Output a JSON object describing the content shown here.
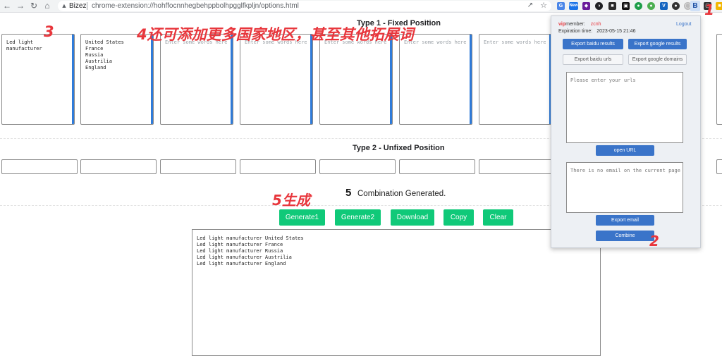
{
  "browser": {
    "site_label": "Bizez",
    "url": "chrome-extension://hohffocnnhegbehppbolhpgglfkpljn/options.html",
    "ext_badge_new": "New",
    "ext_badge_b": "B"
  },
  "type1": {
    "title": "Type 1 - Fixed Position",
    "boxes": [
      {
        "text": "Led light\nmanufacturer"
      },
      {
        "text": "United States\nFrance\nRussia\nAustrilia\nEngland"
      }
    ],
    "placeholder": "Enter some words here"
  },
  "type2": {
    "title": "Type 2 - Unfixed Position"
  },
  "generated": {
    "count": "5",
    "label": "Combination Generated.",
    "buttons": [
      "Generate1",
      "Generate2",
      "Download",
      "Copy",
      "Clear"
    ],
    "output": "Led light manufacturer United States\nLed light manufacturer France\nLed light manufacturer Russia\nLed light manufacturer Austrilia\nLed light manufacturer England"
  },
  "popup": {
    "vip_prefix": "vip",
    "member_label": "member:",
    "member_name": "zcnh",
    "logout": "Logout",
    "expiration_label": "Expiration time:",
    "expiration_value": "2023-05-15 21:46",
    "export_baidu_results": "Export baidu results",
    "export_google_results": "Export google results",
    "export_baidu_urls": "Export baidu urls",
    "export_google_domains": "Export google domains",
    "urls_placeholder": "Please enter your urls",
    "open_url": "open URL",
    "email_placeholder": "There is no email on the current page",
    "export_email": "Export email",
    "combine": "Combine"
  },
  "annotations": {
    "a1": "1",
    "a2": "2",
    "a3": "3",
    "a4": "4还可添加更多国家地区，甚至其他拓展词",
    "a5": "5生成"
  },
  "colors": {
    "green_button": "#10c979",
    "blue_button": "#3a74c9",
    "annotation_red": "#e8363c",
    "box_accent": "#2f7bd9"
  }
}
